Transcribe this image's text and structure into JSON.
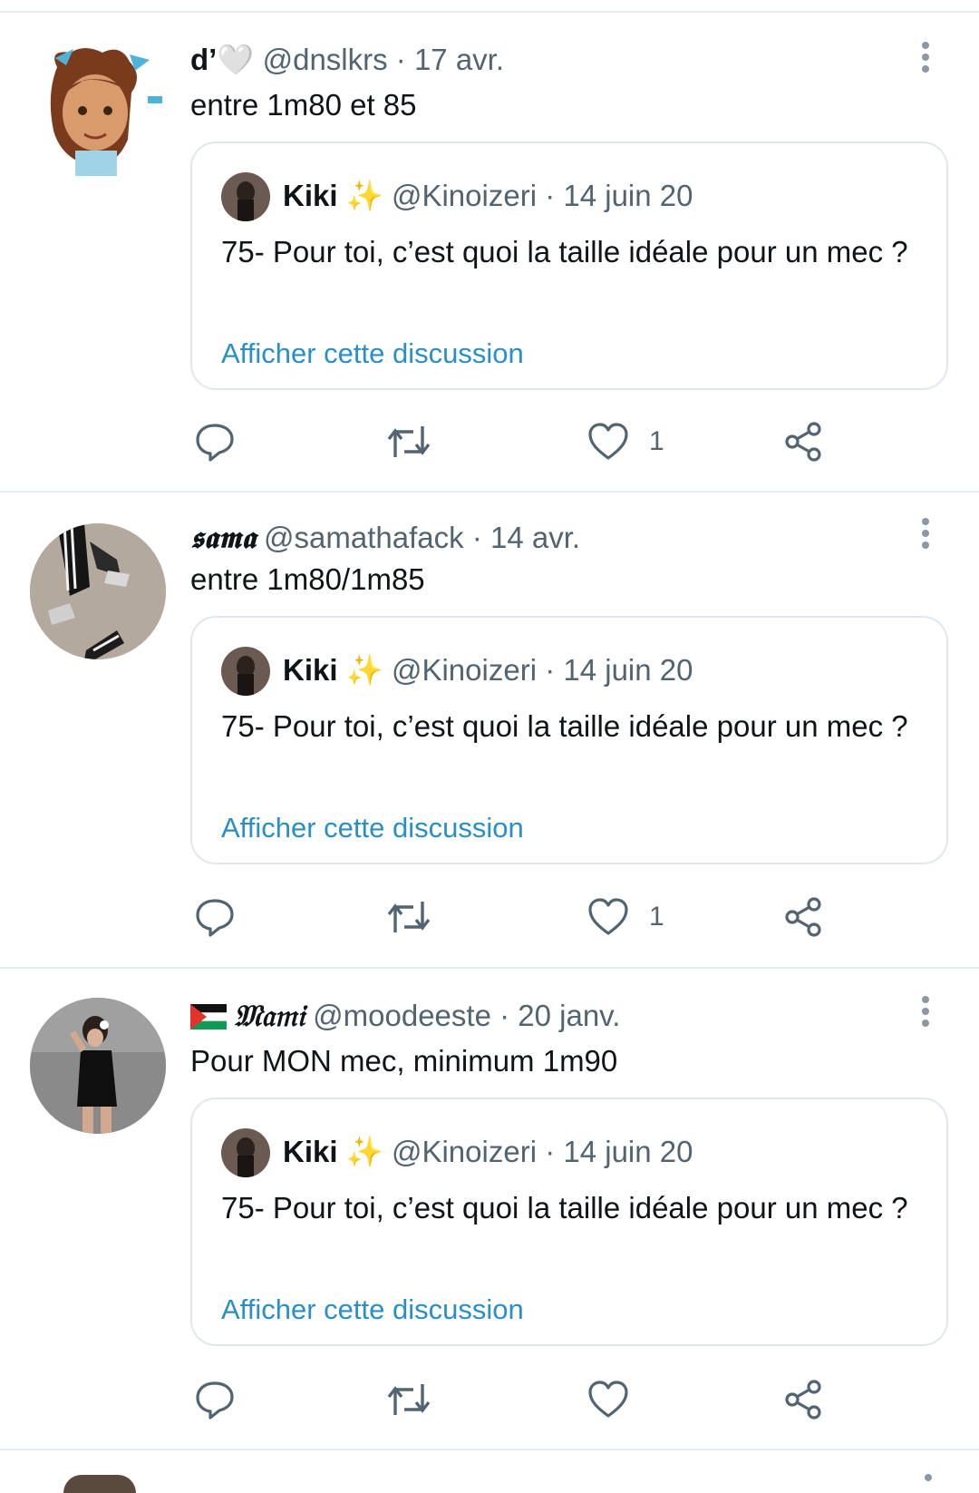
{
  "tweets": [
    {
      "name": "d’",
      "name_emoji": "🤍",
      "handle": "@dnslkrs",
      "date": "· 17 avr.",
      "text": "entre 1m80 et 85",
      "avatar": "cartoon-girl-avatar",
      "likes": "1",
      "quote": {
        "name": "Kiki",
        "emoji": "✨",
        "handle": "@Kinoizeri",
        "date": "· 14 juin 20",
        "text": "75- Pour toi, c’est quoi la taille idéale pour un mec ?",
        "link": "Afficher cette discussion"
      }
    },
    {
      "name": "𝖘𝖆𝖒𝖆",
      "handle": "@samathafack",
      "date": "· 14 avr.",
      "text": "entre 1m80/1m85",
      "avatar": "sneakers-photo-avatar",
      "likes": "1",
      "quote": {
        "name": "Kiki",
        "emoji": "✨",
        "handle": "@Kinoizeri",
        "date": "· 14 juin 20",
        "text": "75- Pour toi, c’est quoi la taille idéale pour un mec ?",
        "link": "Afficher cette discussion"
      }
    },
    {
      "flag": "palestine-flag",
      "name": "𝔐𝔞𝔪𝔦",
      "handle": "@moodeeste",
      "date": "· 20 janv.",
      "text": "Pour MON mec, minimum 1m90",
      "avatar": "mirror-selfie-avatar",
      "likes": "",
      "quote": {
        "name": "Kiki",
        "emoji": "✨",
        "handle": "@Kinoizeri",
        "date": "· 14 juin 20",
        "text": "75- Pour toi, c’est quoi la taille idéale pour un mec ?",
        "link": "Afficher cette discussion"
      }
    }
  ],
  "colors": {
    "link": "#2a8fc7",
    "icon": "#536471",
    "divider": "#e6ecf0"
  },
  "icons": [
    "reply-icon",
    "retweet-icon",
    "like-icon",
    "share-icon",
    "more-icon"
  ]
}
